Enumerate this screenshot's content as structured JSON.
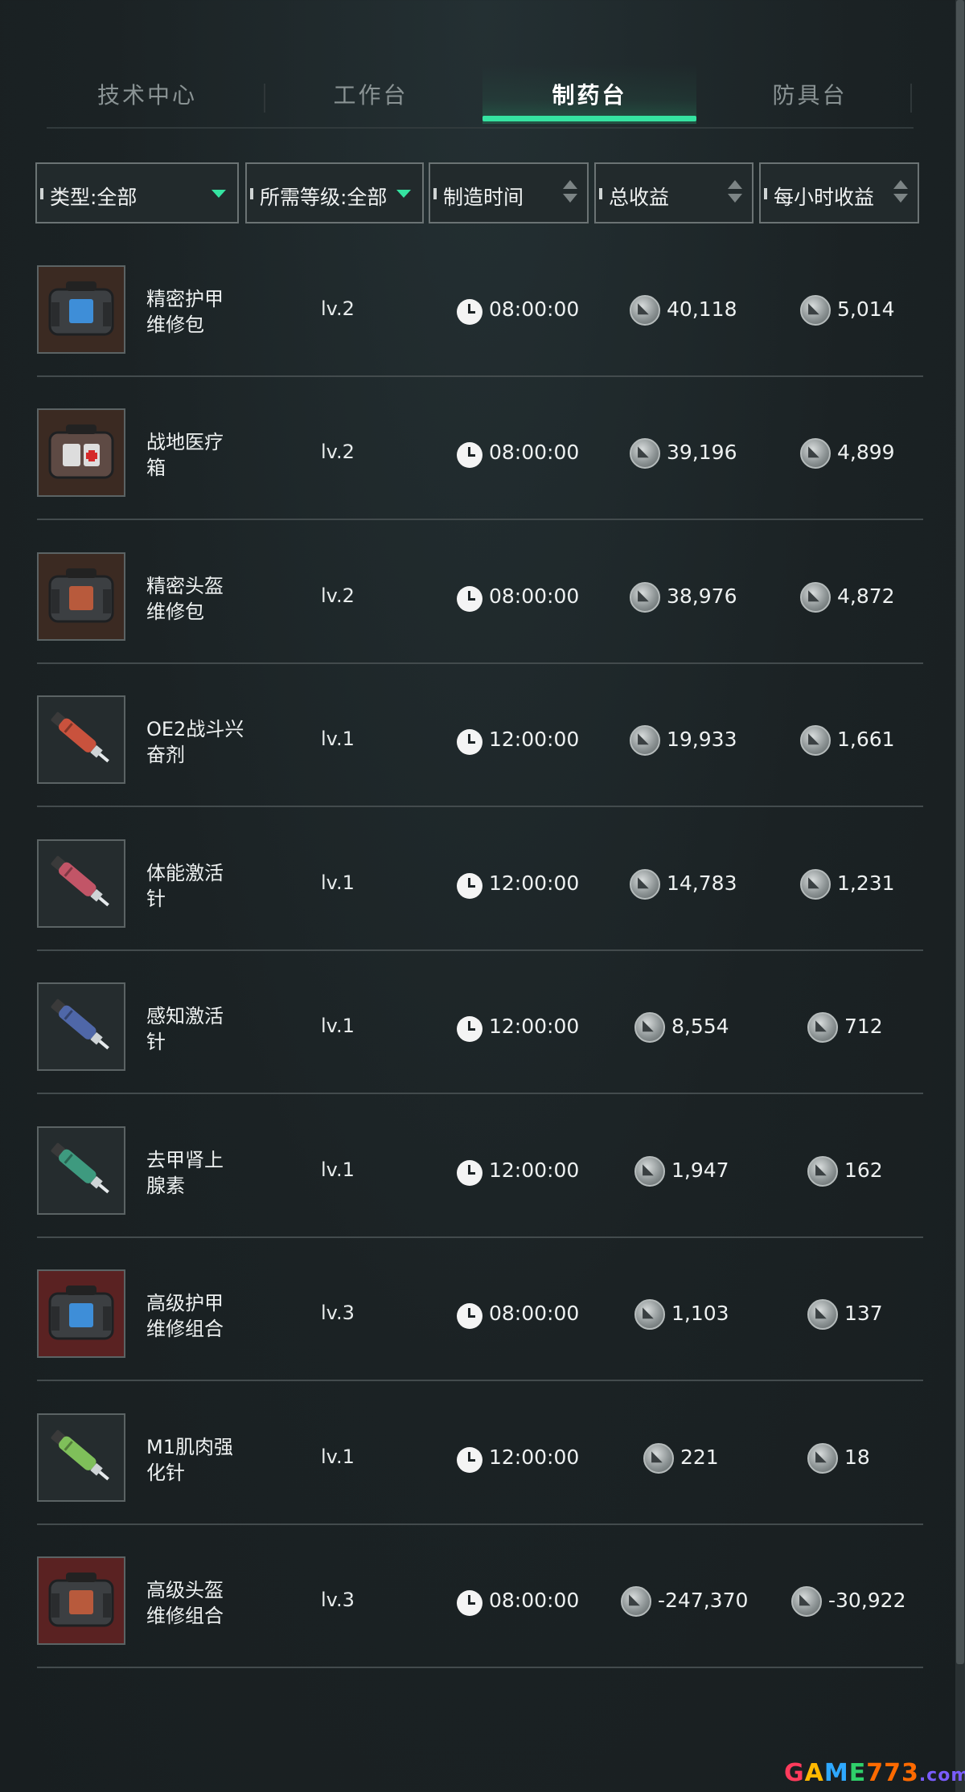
{
  "tabs": [
    {
      "label": "技术中心",
      "active": false
    },
    {
      "label": "工作台",
      "active": false
    },
    {
      "label": "制药台",
      "active": true
    },
    {
      "label": "防具台",
      "active": false
    }
  ],
  "filters": {
    "type": "类型:全部",
    "level": "所需等级:全部",
    "time": "制造时间",
    "total": "总收益",
    "hourly": "每小时收益"
  },
  "rows": [
    {
      "name": "精密护甲维修包",
      "name_l1": "精密护甲",
      "name_l2": "维修包",
      "level": "lv.2",
      "time": "08:00:00",
      "total": "40,118",
      "hourly": "5,014",
      "icon": "armor-repair-kit-icon"
    },
    {
      "name": "战地医疗箱",
      "name_l1": "战地医疗",
      "name_l2": "箱",
      "level": "lv.2",
      "time": "08:00:00",
      "total": "39,196",
      "hourly": "4,899",
      "icon": "medical-box-icon"
    },
    {
      "name": "精密头盔维修包",
      "name_l1": "精密头盔",
      "name_l2": "维修包",
      "level": "lv.2",
      "time": "08:00:00",
      "total": "38,976",
      "hourly": "4,872",
      "icon": "helmet-repair-kit-icon"
    },
    {
      "name": "OE2战斗兴奋剂",
      "name_l1": "OE2战斗兴",
      "name_l2": "奋剂",
      "level": "lv.1",
      "time": "12:00:00",
      "total": "19,933",
      "hourly": "1,661",
      "icon": "syringe-icon"
    },
    {
      "name": "体能激活针",
      "name_l1": "体能激活",
      "name_l2": "针",
      "level": "lv.1",
      "time": "12:00:00",
      "total": "14,783",
      "hourly": "1,231",
      "icon": "syringe-icon"
    },
    {
      "name": "感知激活针",
      "name_l1": "感知激活",
      "name_l2": "针",
      "level": "lv.1",
      "time": "12:00:00",
      "total": "8,554",
      "hourly": "712",
      "icon": "syringe-icon"
    },
    {
      "name": "去甲肾上腺素",
      "name_l1": "去甲肾上",
      "name_l2": "腺素",
      "level": "lv.1",
      "time": "12:00:00",
      "total": "1,947",
      "hourly": "162",
      "icon": "syringe-icon"
    },
    {
      "name": "高级护甲维修组合",
      "name_l1": "高级护甲",
      "name_l2": "维修组合",
      "level": "lv.3",
      "time": "08:00:00",
      "total": "1,103",
      "hourly": "137",
      "icon": "armor-repair-combo-icon"
    },
    {
      "name": "M1肌肉强化针",
      "name_l1": "M1肌肉强",
      "name_l2": "化针",
      "level": "lv.1",
      "time": "12:00:00",
      "total": "221",
      "hourly": "18",
      "icon": "syringe-icon"
    },
    {
      "name": "高级头盔维修组合",
      "name_l1": "高级头盔",
      "name_l2": "维修组合",
      "level": "lv.3",
      "time": "08:00:00",
      "total": "-247,370",
      "hourly": "-30,922",
      "icon": "helmet-repair-combo-icon"
    }
  ],
  "colors": {
    "accent": "#35e3a1",
    "background": "#1b2224"
  },
  "watermark": {
    "g": "G",
    "a": "A",
    "m": "M",
    "e": "E",
    "num": "773",
    "dom": ".com"
  }
}
